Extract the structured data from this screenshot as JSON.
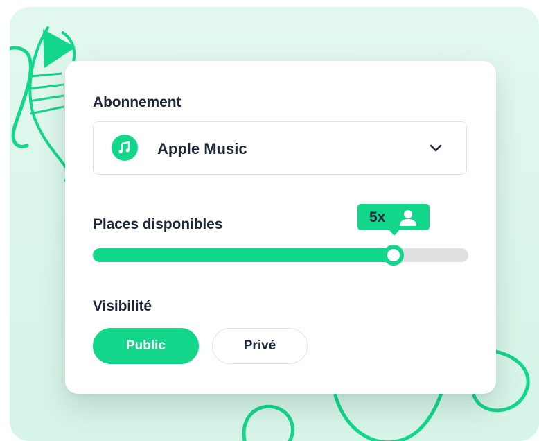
{
  "subscription": {
    "label": "Abonnement",
    "selected_value": "Apple Music",
    "icon": "music-note-icon",
    "chevron_icon": "chevron-down-icon"
  },
  "seats": {
    "label": "Places disponibles",
    "badge_count": "5x",
    "badge_icon": "person-icon",
    "slider_fraction": 0.8
  },
  "visibility": {
    "label": "Visibilité",
    "options": [
      "Public",
      "Privé"
    ],
    "selected": "Public"
  },
  "colors": {
    "accent": "#12d68a",
    "text": "#1d2639",
    "background": "#d9f5e8",
    "track": "#e0e0e2"
  }
}
